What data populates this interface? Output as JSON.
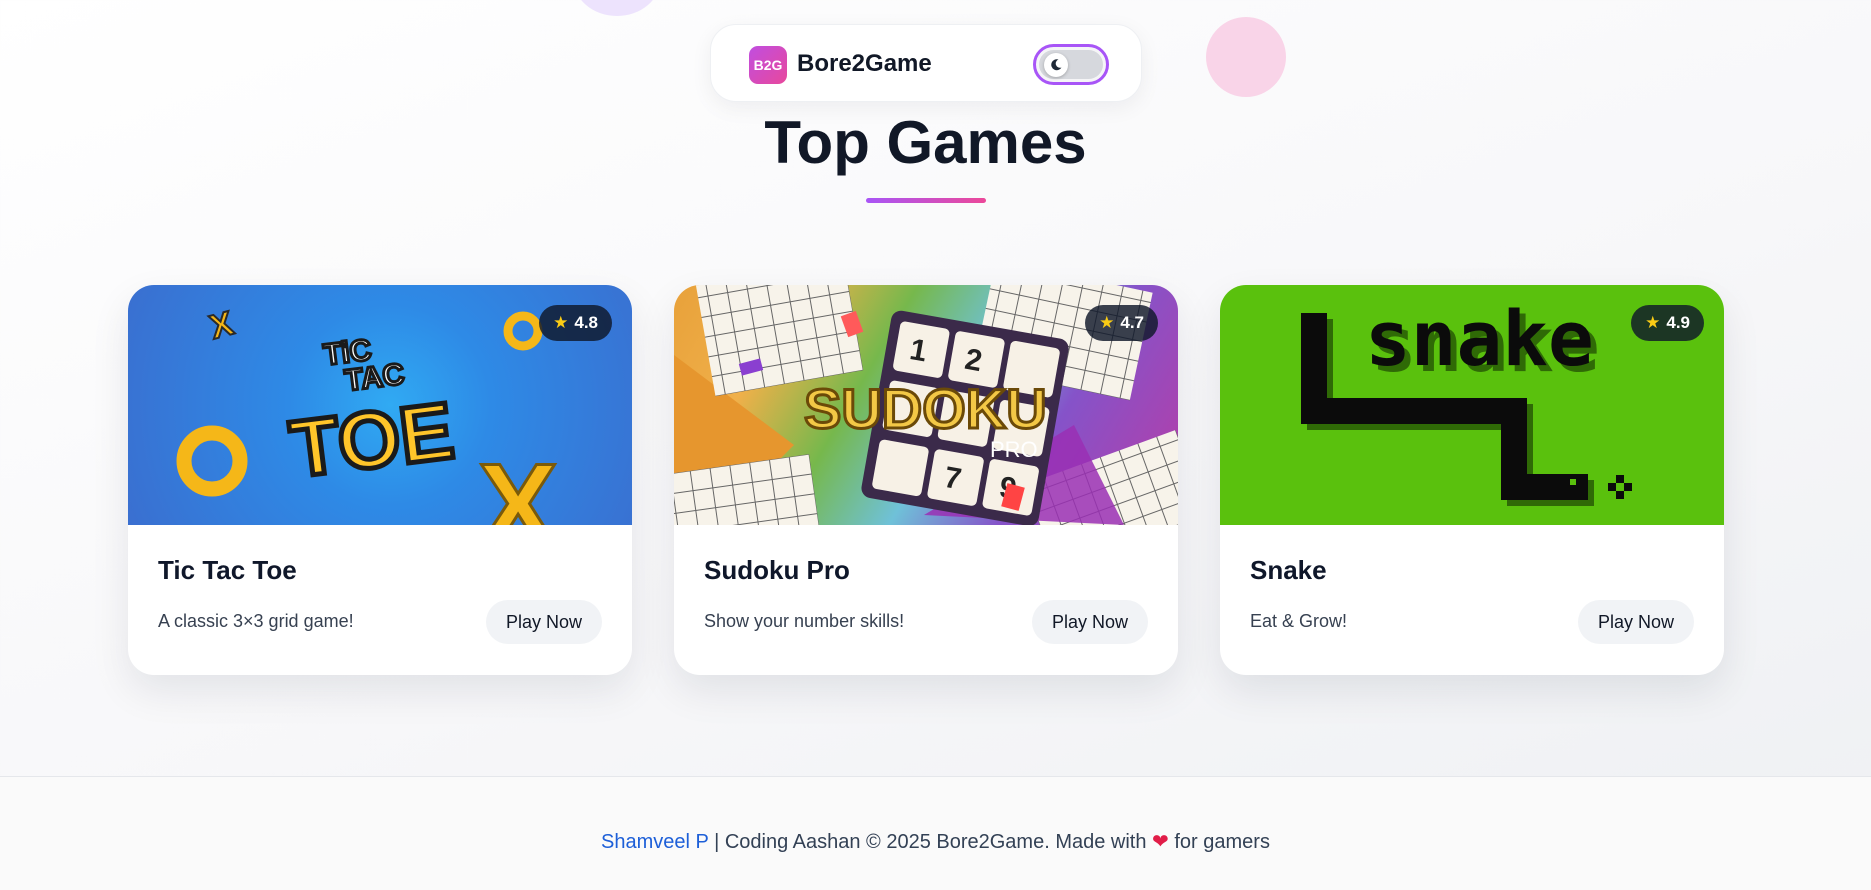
{
  "navbar": {
    "logo_text": "B2G",
    "brand": "Bore2Game",
    "theme_toggle_icon": "moon-icon"
  },
  "page": {
    "title": "Top Games"
  },
  "games": [
    {
      "title": "Tic Tac Toe",
      "description": "A classic 3×3 grid game!",
      "rating": "4.8",
      "play_label": "Play Now",
      "logo_text": [
        "TiC",
        "TAC",
        "TOE"
      ]
    },
    {
      "title": "Sudoku Pro",
      "description": "Show your number skills!",
      "rating": "4.7",
      "play_label": "Play Now",
      "logo_text": [
        "SUDOKU",
        "PRO"
      ]
    },
    {
      "title": "Snake",
      "description": "Eat & Grow!",
      "rating": "4.9",
      "play_label": "Play Now",
      "logo_text": [
        "snake"
      ]
    }
  ],
  "footer": {
    "author": "Shamveel P",
    "text_before_heart": "| Coding Aashan © 2025 Bore2Game. Made with",
    "heart": "❤",
    "text_after_heart": "for gamers"
  },
  "colors": {
    "accent_purple": "#a855f7",
    "accent_pink": "#ec4899",
    "link_blue": "#1d5fd8",
    "heart_red": "#e11d48",
    "star_yellow": "#facc15"
  }
}
